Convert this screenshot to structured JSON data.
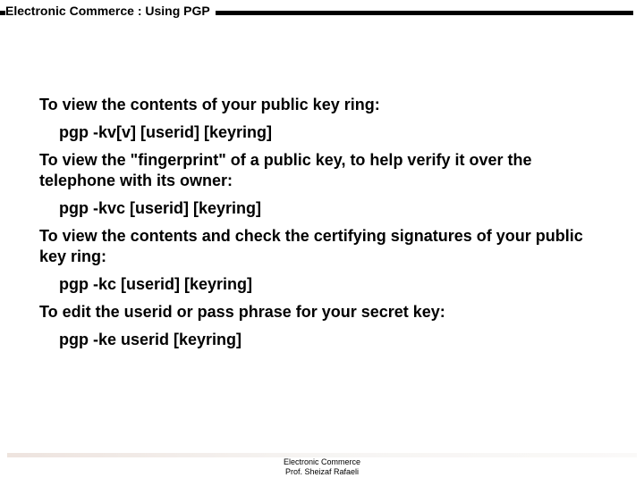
{
  "header": {
    "title": "Electronic Commerce :  Using PGP"
  },
  "body": {
    "p1": "To view the contents of your public key ring:",
    "c1": "pgp -kv[v] [userid] [keyring]",
    "p2": "To view the \"fingerprint\" of a public key, to help verify it over the telephone with its owner:",
    "c2": "pgp -kvc [userid] [keyring]",
    "p3": "To view the contents and check the certifying signatures of your public key ring:",
    "c3": "pgp -kc [userid] [keyring]",
    "p4": "To edit the userid or pass phrase for your secret key:",
    "c4": "pgp -ke userid [keyring]"
  },
  "footer": {
    "line1": "Electronic Commerce",
    "line2": "Prof. Sheizaf Rafaeli"
  }
}
